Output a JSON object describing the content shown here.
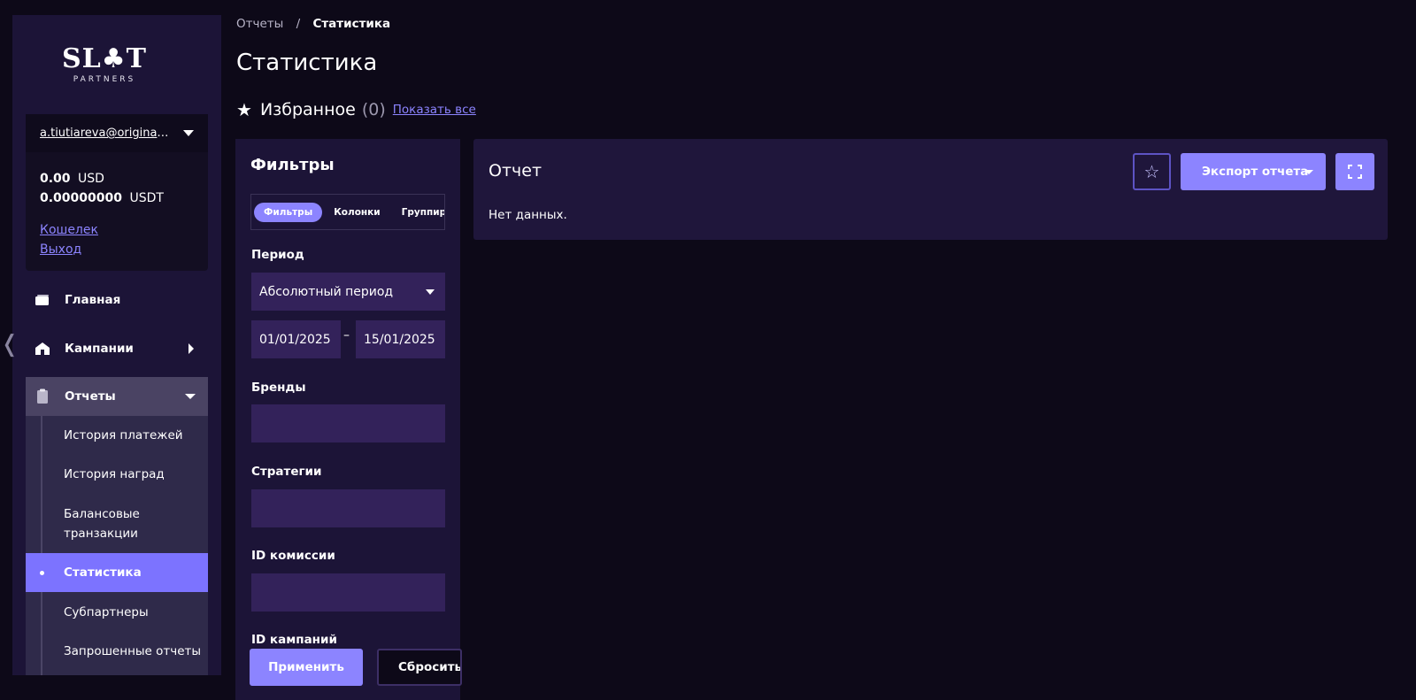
{
  "sidebar": {
    "logo_main": "SL♣T",
    "logo_sub": "PARTNERS",
    "account": {
      "email": "a.tiutiareva@originalspirit.ru",
      "balance_usd_value": "0.00",
      "balance_usd_currency": "USD",
      "balance_usdt_value": "0.00000000",
      "balance_usdt_currency": "USDT",
      "wallet_link": "Кошелек",
      "logout_link": "Выход"
    },
    "nav": {
      "home": "Главная",
      "campaigns": "Кампании",
      "reports": "Отчеты"
    },
    "submenu": [
      "История платежей",
      "История наград",
      "Балансовые транзакции",
      "Статистика",
      "Субпартнеры",
      "Запрошенные отчеты"
    ],
    "collapse_glyph": "❬"
  },
  "header": {
    "breadcrumb_parent": "Отчеты",
    "breadcrumb_sep": "/",
    "breadcrumb_current": "Статистика",
    "title": "Статистика",
    "favorites_label": "Избранное",
    "favorites_count": "(0)",
    "favorites_show_all": "Показать все"
  },
  "filters": {
    "title": "Фильтры",
    "tabs": [
      "Фильтры",
      "Колонки",
      "Группировать"
    ],
    "period_label": "Период",
    "period_value": "Абсолютный период",
    "date_from": "01/01/2025",
    "date_to": "15/01/2025",
    "date_dash": "–",
    "brands_label": "Бренды",
    "strategies_label": "Стратегии",
    "commission_label": "ID комиссии",
    "campaigns_label": "ID кампаний",
    "apply_button": "Применить",
    "reset_button": "Сбросить"
  },
  "report": {
    "title": "Отчет",
    "empty_text": "Нет данных.",
    "export_button": "Экспорт отчета",
    "favorite_glyph": "☆"
  },
  "colors": {
    "background": "#0d0918",
    "panel": "#1c1437",
    "accent": "#8c84ff",
    "input": "#33225a"
  }
}
